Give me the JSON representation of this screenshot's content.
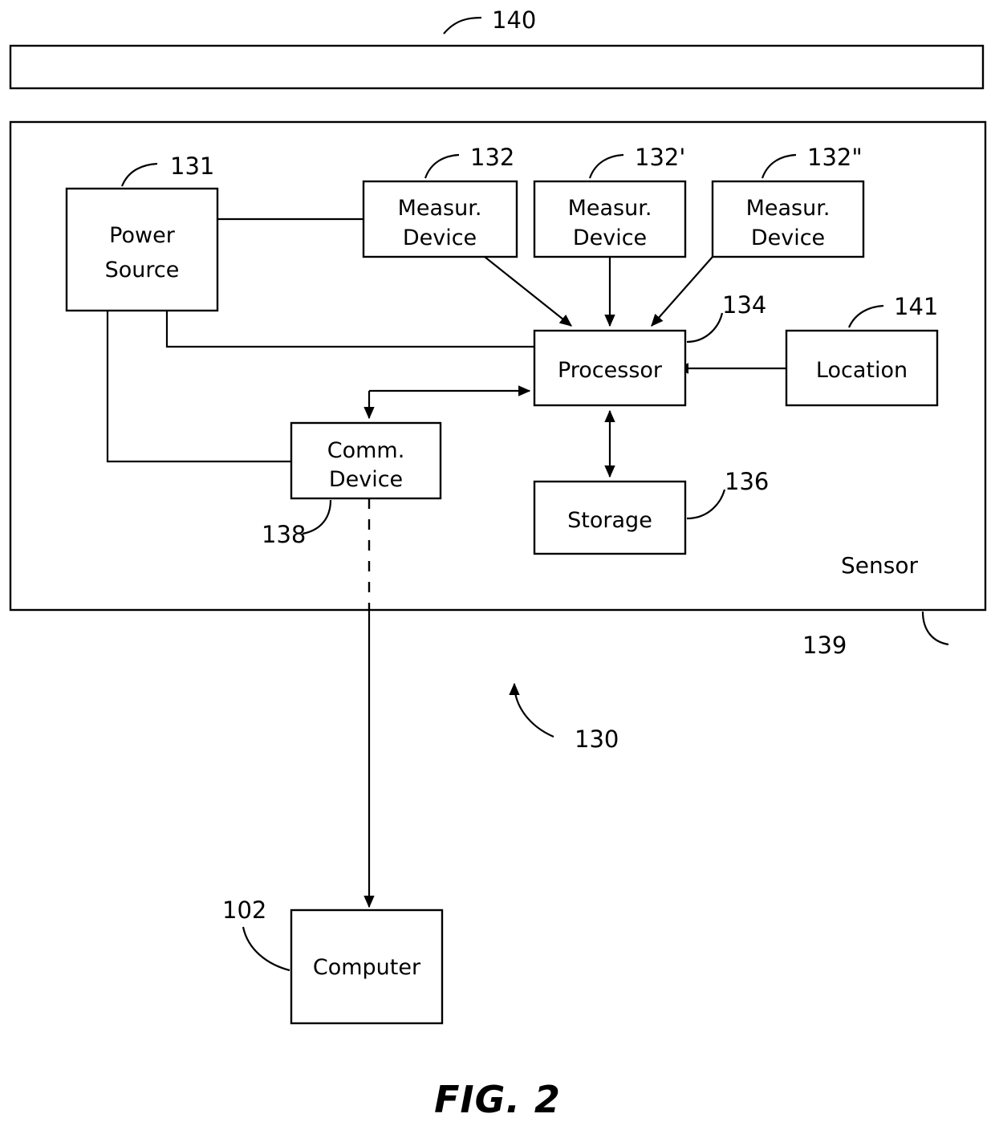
{
  "figure": {
    "caption": "FIG. 2"
  },
  "nodes": {
    "power_source": {
      "line1": "Power",
      "line2": "Source",
      "ref": "131"
    },
    "measur_device_1": {
      "line1": "Measur.",
      "line2": "Device",
      "ref": "132"
    },
    "measur_device_2": {
      "line1": "Measur.",
      "line2": "Device",
      "ref": "132'"
    },
    "measur_device_3": {
      "line1": "Measur.",
      "line2": "Device",
      "ref": "132\""
    },
    "processor": {
      "label": "Processor",
      "ref": "134"
    },
    "location": {
      "label": "Location",
      "ref": "141"
    },
    "comm_device": {
      "line1": "Comm.",
      "line2": "Device",
      "ref": "138"
    },
    "storage": {
      "label": "Storage",
      "ref": "136"
    },
    "computer": {
      "label": "Computer",
      "ref": "102"
    },
    "sensor_enclosure": {
      "label": "Sensor",
      "ref": "139"
    },
    "top_bar": {
      "ref": "140"
    },
    "system": {
      "ref": "130"
    }
  }
}
